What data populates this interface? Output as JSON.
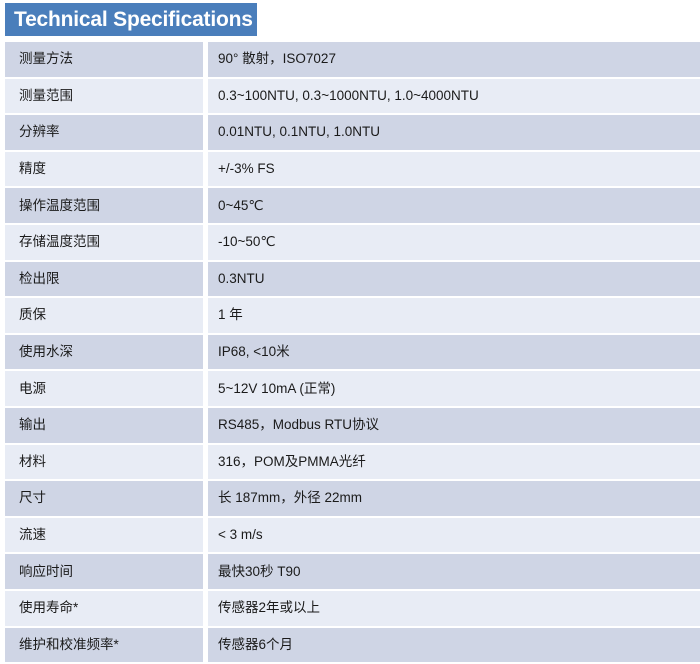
{
  "header": {
    "title": "Technical Specifications",
    "background_color": "#4a7ebb",
    "text_color": "#ffffff"
  },
  "table": {
    "band_dark_color": "#cfd5e5",
    "band_light_color": "#e8ecf5",
    "rows": [
      {
        "label": "测量方法",
        "value": "90° 散射，ISO7027"
      },
      {
        "label": "测量范围",
        "value": "0.3~100NTU, 0.3~1000NTU, 1.0~4000NTU"
      },
      {
        "label": "分辨率",
        "value": "0.01NTU, 0.1NTU, 1.0NTU"
      },
      {
        "label": "精度",
        "value": "+/-3% FS"
      },
      {
        "label": "操作温度范围",
        "value": "0~45℃"
      },
      {
        "label": "存储温度范围",
        "value": "-10~50℃"
      },
      {
        "label": "检出限",
        "value": "0.3NTU"
      },
      {
        "label": "质保",
        "value": "1 年"
      },
      {
        "label": "使用水深",
        "value": "IP68, <10米"
      },
      {
        "label": "电源",
        "value": "5~12V 10mA (正常)"
      },
      {
        "label": "输出",
        "value": "RS485，Modbus RTU协议"
      },
      {
        "label": "材料",
        "value": "316，POM及PMMA光纤"
      },
      {
        "label": "尺寸",
        "value": "长 187mm，外径 22mm"
      },
      {
        "label": "流速",
        "value": "< 3 m/s"
      },
      {
        "label": "响应时间",
        "value": "最快30秒 T90"
      },
      {
        "label": "使用寿命*",
        "value": "传感器2年或以上"
      },
      {
        "label": "维护和校准频率*",
        "value": "传感器6个月"
      }
    ]
  }
}
